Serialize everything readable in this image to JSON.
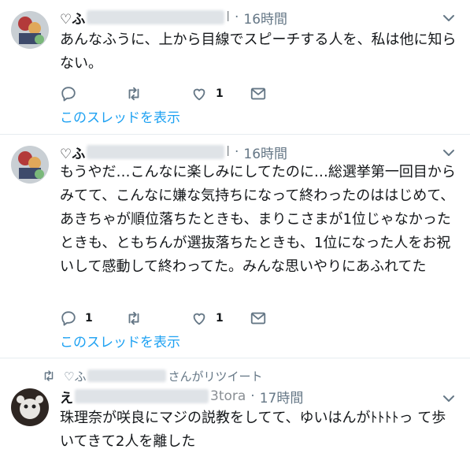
{
  "tweets": [
    {
      "name_prefix": "♡ふ",
      "handle_tail": "l",
      "time": "16時間",
      "text": "あんなふうに、上から目線でスピーチする人を、私は他に知らない。",
      "reply_count": "",
      "retweet_count": "",
      "like_count": "1",
      "thread_link": "このスレッドを表示"
    },
    {
      "name_prefix": "♡ふ",
      "handle_tail": "l",
      "time": "16時間",
      "text": "もうやだ…こんなに楽しみにしてたのに…総選挙第一回目からみてて、こんなに嫌な気持ちになって終わったのははじめて、あきちゃが順位落ちたときも、まりこさまが1位じゃなかったときも、ともちんが選抜落ちたときも、1位になった人をお祝いして感動して終わってた。みんな思いやりにあふれてた",
      "reply_count": "1",
      "retweet_count": "",
      "like_count": "1",
      "thread_link": "このスレッドを表示"
    },
    {
      "retweet_notice_prefix": "♡ふ",
      "retweet_notice_suffix": "さんがリツイート",
      "name_prefix": "え",
      "handle_tail": "3tora",
      "time": "17時間",
      "text": "珠理奈が咲良にマジの説教をしてて、ゆいはんがﾄﾄﾄﾄっ て歩いてきて2人を離した"
    }
  ],
  "separator": "·",
  "colors": {
    "accent": "#1da1f2",
    "muted": "#657786",
    "text": "#14171a",
    "border": "#e6ecf0"
  },
  "icons": [
    "reply-icon",
    "retweet-icon",
    "like-icon",
    "message-icon",
    "chevron-down-icon",
    "avatar"
  ]
}
